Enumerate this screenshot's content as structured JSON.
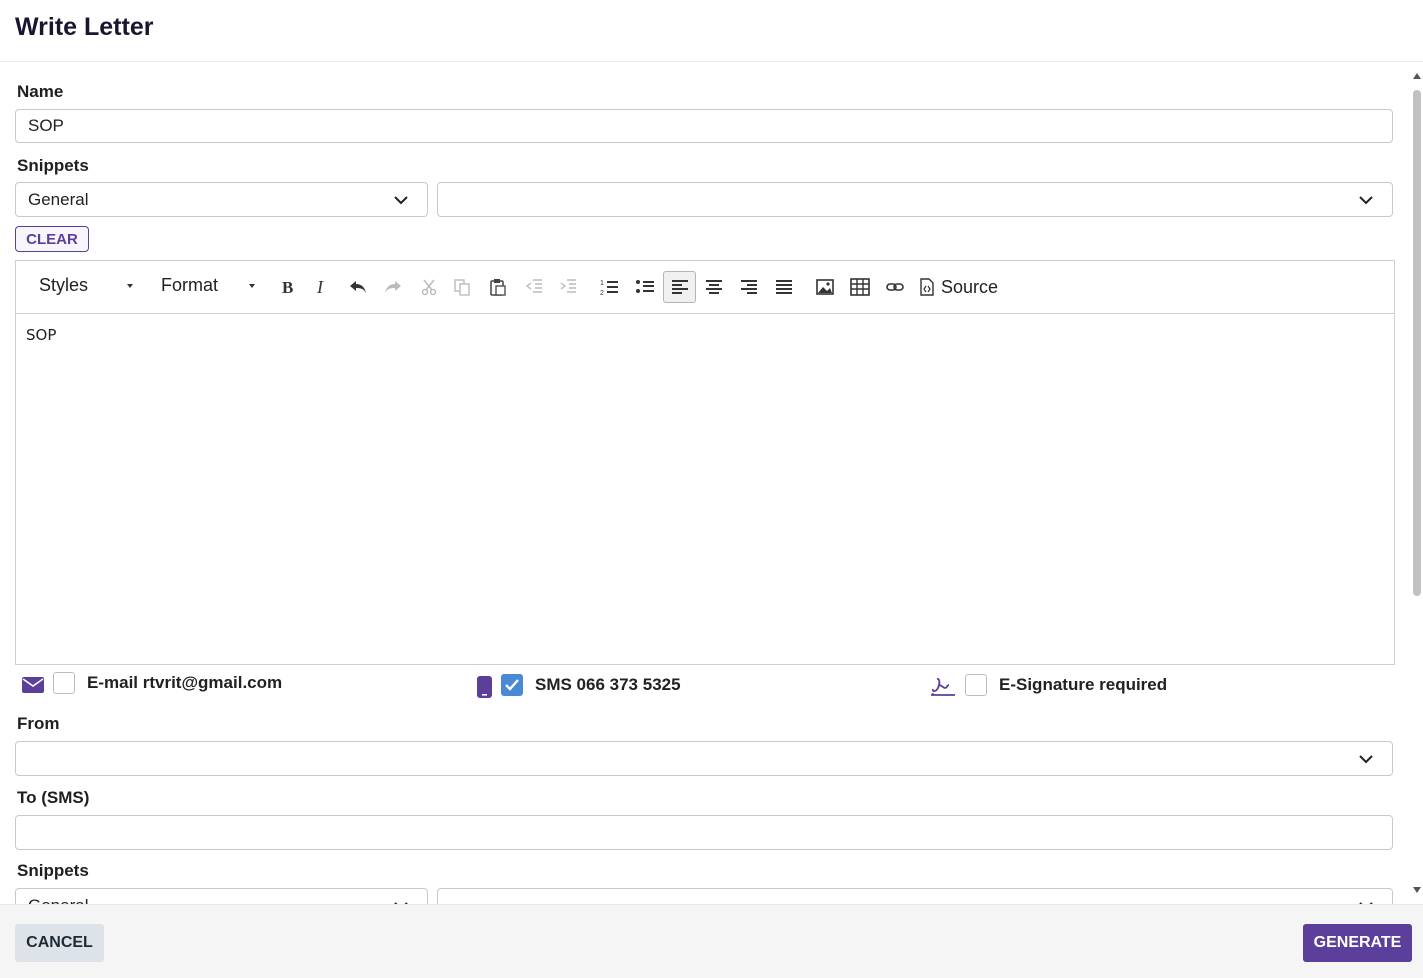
{
  "dialog": {
    "title": "Write Letter"
  },
  "name": {
    "label": "Name",
    "value": "SOP"
  },
  "snippets": {
    "label": "Snippets",
    "category": "General",
    "item": ""
  },
  "clear_label": "CLEAR",
  "editor": {
    "styles_label": "Styles",
    "format_label": "Format",
    "source_label": "Source",
    "icons": [
      "bold-icon",
      "italic-icon",
      "undo-icon",
      "redo-icon",
      "cut-icon",
      "copy-icon",
      "paste-icon",
      "outdent-icon",
      "indent-icon",
      "numbered-list-icon",
      "bulleted-list-icon",
      "align-left-icon",
      "align-center-icon",
      "align-right-icon",
      "justify-icon",
      "image-icon",
      "table-icon",
      "link-icon",
      "source-icon"
    ],
    "content": "SOP"
  },
  "options": {
    "email": {
      "label": "E-mail rtvrit@gmail.com",
      "checked": false
    },
    "sms": {
      "label": "SMS 066 373 5325",
      "checked": true
    },
    "esign": {
      "label": "E-Signature required",
      "checked": false
    }
  },
  "from": {
    "label": "From",
    "value": ""
  },
  "to_sms": {
    "label": "To (SMS)",
    "value": ""
  },
  "snippets2": {
    "label": "Snippets",
    "category": "General",
    "item": ""
  },
  "footer": {
    "cancel_label": "CANCEL",
    "generate_label": "GENERATE"
  },
  "colors": {
    "accent": "#5c3f9a",
    "check": "#4a8ad4"
  }
}
